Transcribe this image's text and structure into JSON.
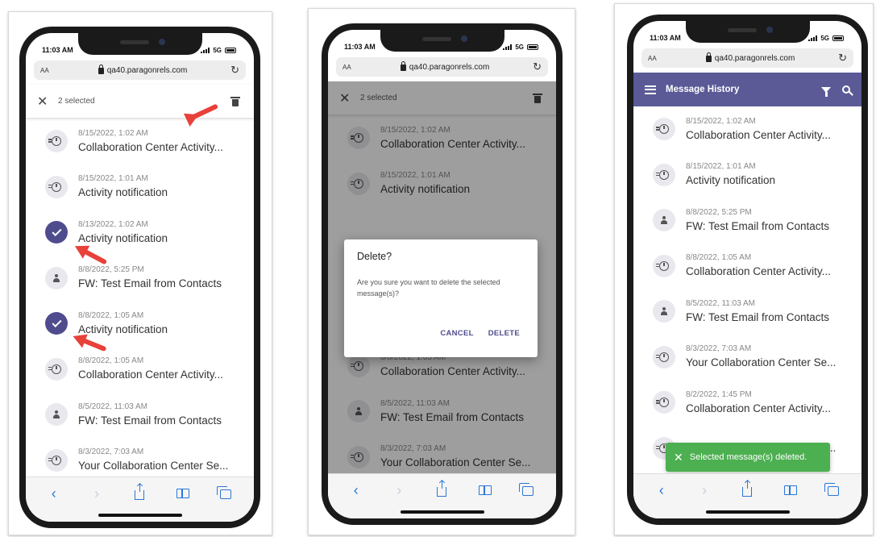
{
  "status": {
    "time": "11:03 AM",
    "network": "5G"
  },
  "browser": {
    "aa_label": "AA",
    "url": "qa40.paragonrels.com"
  },
  "panel1": {
    "selected_count": "2 selected",
    "rows": [
      {
        "date": "8/15/2022, 1:02 AM",
        "title": "Collaboration Center Activity...",
        "icon": "timer-icon",
        "checked": false
      },
      {
        "date": "8/15/2022, 1:01 AM",
        "title": "Activity notification",
        "icon": "timer-icon",
        "checked": false
      },
      {
        "date": "8/13/2022, 1:02 AM",
        "title": "Activity notification",
        "icon": "check-icon",
        "checked": true
      },
      {
        "date": "8/8/2022, 5:25 PM",
        "title": "FW: Test Email from Contacts",
        "icon": "person-icon",
        "checked": false
      },
      {
        "date": "8/8/2022, 1:05 AM",
        "title": "Activity notification",
        "icon": "check-icon",
        "checked": true
      },
      {
        "date": "8/8/2022, 1:05 AM",
        "title": "Collaboration Center Activity...",
        "icon": "timer-icon",
        "checked": false
      },
      {
        "date": "8/5/2022, 11:03 AM",
        "title": "FW: Test Email from Contacts",
        "icon": "person-icon",
        "checked": false
      },
      {
        "date": "8/3/2022, 7:03 AM",
        "title": "Your Collaboration Center Se...",
        "icon": "timer-icon",
        "checked": false
      }
    ]
  },
  "panel2": {
    "selected_count": "2 selected",
    "rows_top": [
      {
        "date": "8/15/2022, 1:02 AM",
        "title": "Collaboration Center Activity...",
        "icon": "timer-icon"
      },
      {
        "date": "8/15/2022, 1:01 AM",
        "title": "Activity notification",
        "icon": "timer-icon"
      }
    ],
    "rows_bottom": [
      {
        "date": "8/8/2022, 1:05 AM",
        "title": "Collaboration Center Activity...",
        "icon": "timer-icon"
      },
      {
        "date": "8/5/2022, 11:03 AM",
        "title": "FW: Test Email from Contacts",
        "icon": "person-icon"
      },
      {
        "date": "8/3/2022, 7:03 AM",
        "title": "Your Collaboration Center Se...",
        "icon": "timer-icon"
      }
    ],
    "dialog": {
      "title": "Delete?",
      "body": "Are you sure you want to delete the selected message(s)?",
      "cancel": "CANCEL",
      "delete": "DELETE"
    }
  },
  "panel3": {
    "title": "Message History",
    "rows": [
      {
        "date": "8/15/2022, 1:02 AM",
        "title": "Collaboration Center Activity...",
        "icon": "timer-icon"
      },
      {
        "date": "8/15/2022, 1:01 AM",
        "title": "Activity notification",
        "icon": "timer-icon"
      },
      {
        "date": "8/8/2022, 5:25 PM",
        "title": "FW: Test Email from Contacts",
        "icon": "person-icon"
      },
      {
        "date": "8/8/2022, 1:05 AM",
        "title": "Collaboration Center Activity...",
        "icon": "timer-icon"
      },
      {
        "date": "8/5/2022, 11:03 AM",
        "title": "FW: Test Email from Contacts",
        "icon": "person-icon"
      },
      {
        "date": "8/3/2022, 7:03 AM",
        "title": "Your Collaboration Center Se...",
        "icon": "timer-icon"
      },
      {
        "date": "8/2/2022, 1:45 PM",
        "title": "Collaboration Center Activity...",
        "icon": "timer-icon"
      },
      {
        "date": "",
        "title": "Your Collaboration Center Se...",
        "icon": "timer-icon"
      }
    ],
    "toast": "Selected message(s) deleted."
  },
  "colors": {
    "accent": "#5b5a96",
    "toast": "#4caf50",
    "annotation_arrow": "#e8413a",
    "ios_blue": "#2b77d6"
  }
}
